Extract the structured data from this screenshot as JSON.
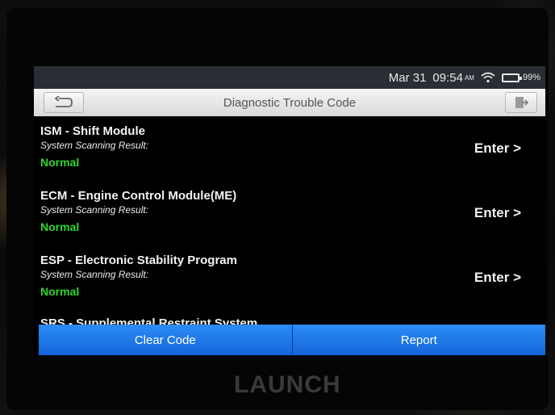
{
  "status_bar": {
    "date": "Mar 31",
    "time": "09:54",
    "meridiem": "AM",
    "battery_percent": "99%",
    "wifi_icon": "wifi-icon",
    "battery_icon": "battery-icon"
  },
  "header": {
    "title": "Diagnostic Trouble Code",
    "back_icon": "back-arrow-icon",
    "exit_icon": "exit-icon"
  },
  "modules": [
    {
      "name": "ISM - Shift Module",
      "result_label": "System Scanning Result:",
      "result": "Normal",
      "action": "Enter >"
    },
    {
      "name": "ECM - Engine Control Module(ME)",
      "result_label": "System Scanning Result:",
      "result": "Normal",
      "action": "Enter >"
    },
    {
      "name": "ESP - Electronic Stability Program",
      "result_label": "System Scanning Result:",
      "result": "Normal",
      "action": "Enter >"
    },
    {
      "name": "SRS - Supplemental Restraint System"
    }
  ],
  "footer": {
    "clear_code": "Clear Code",
    "report": "Report"
  },
  "brand": "LAUNCH",
  "colors": {
    "accent_blue": "#1e7bf0",
    "status_normal": "#2fd62f"
  }
}
